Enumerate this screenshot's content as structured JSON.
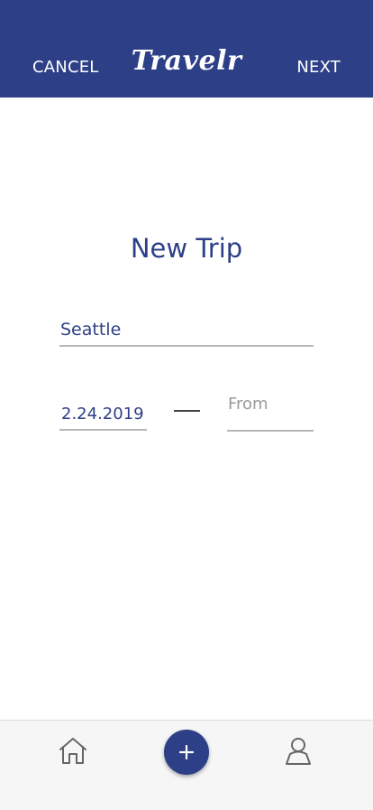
{
  "header": {
    "cancel_label": "CANCEL",
    "logo_text": "Travelr",
    "next_label": "NEXT",
    "background_color": "#2d3f87"
  },
  "form": {
    "title": "New Trip",
    "destination_value": "Seattle",
    "start_date_value": "2.24.2019",
    "end_date_placeholder": "From"
  },
  "tabbar": {
    "icons": [
      "home-icon",
      "plus-icon",
      "user-icon"
    ]
  },
  "colors": {
    "accent": "#2d3f87",
    "placeholder": "#9a9a9a"
  }
}
